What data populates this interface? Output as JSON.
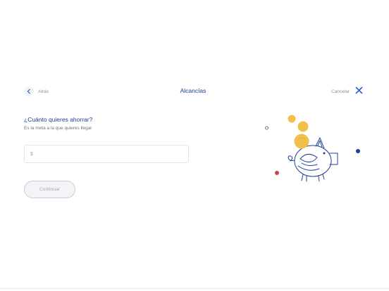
{
  "header": {
    "back_label": "Atrás",
    "title": "Alcancías",
    "cancel_label": "Cancelar"
  },
  "form": {
    "question": "¿Cuánto quieres ahorrar?",
    "subtext": "Es la meta a la que quieres llegar",
    "currency_symbol": "$",
    "amount_value": "",
    "continue_label": "Continuar"
  },
  "colors": {
    "brand_blue": "#1b3d8f",
    "accent_blue": "#2d5bd1",
    "coin_yellow": "#f2c04a",
    "dot_red": "#c8424a",
    "dot_navy": "#1f3f9a"
  },
  "icons": {
    "back": "chevron-left-icon",
    "cancel": "close-icon",
    "illustration": "piggy-bank-illustration"
  }
}
